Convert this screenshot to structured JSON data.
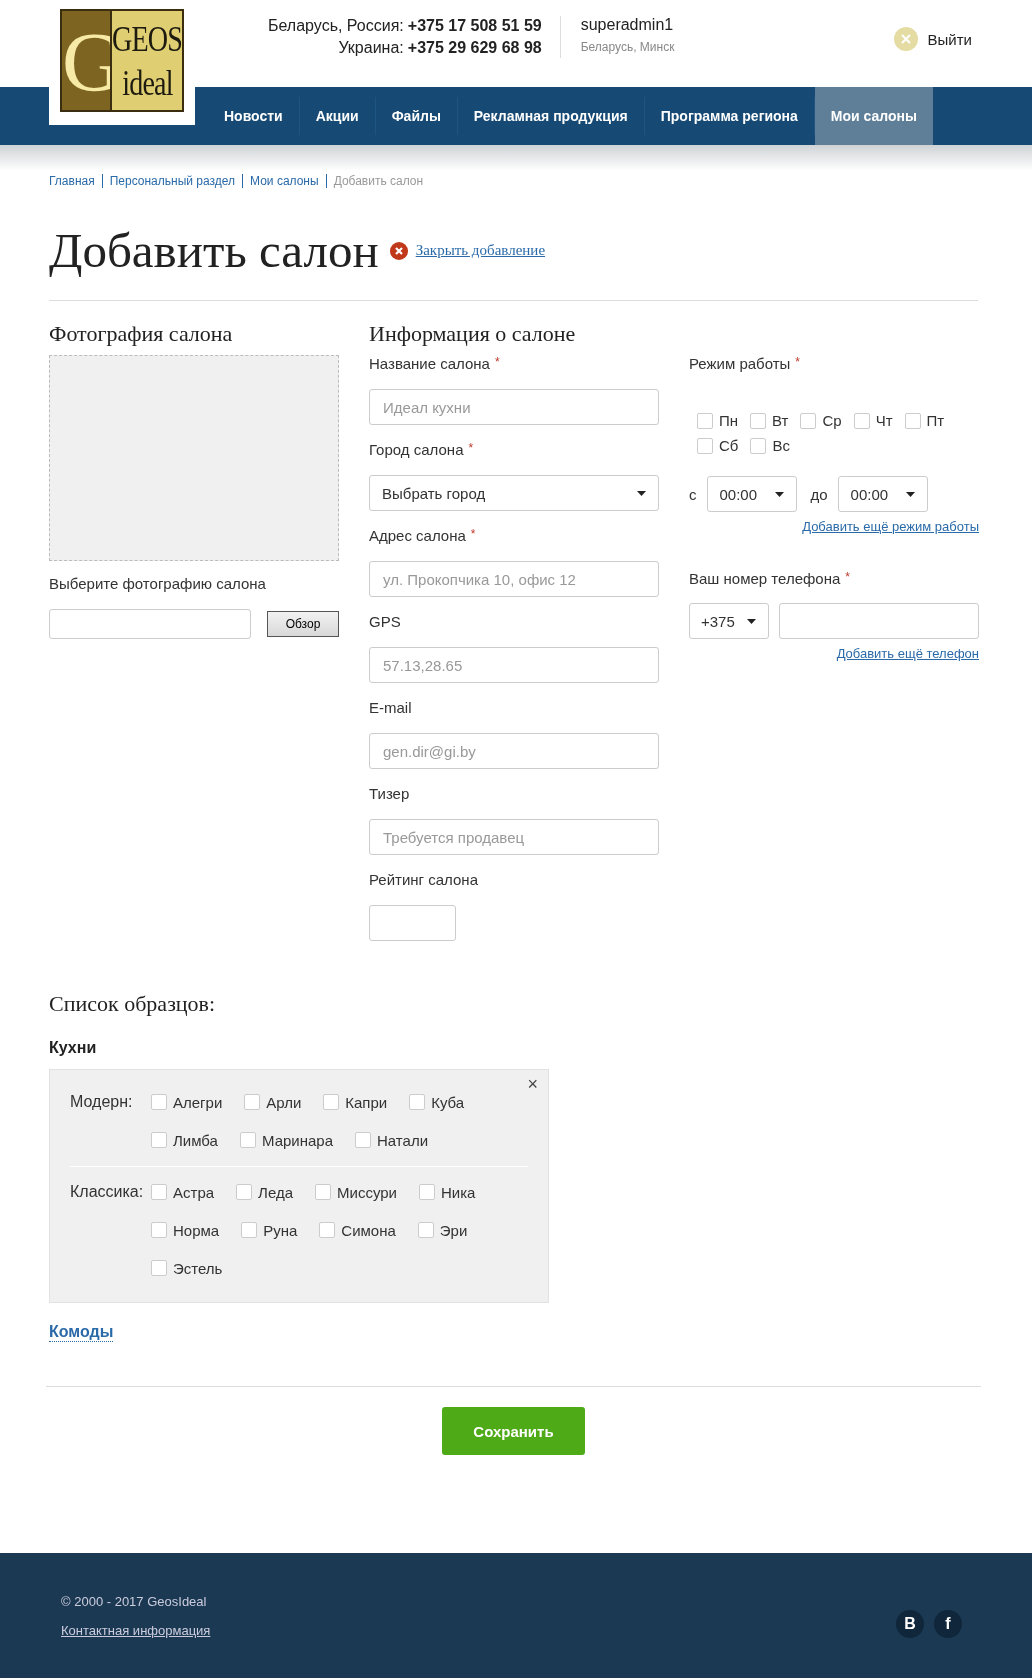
{
  "header": {
    "logo": {
      "letter": "G",
      "top": "GEOS",
      "bottom": "ideal"
    },
    "contacts": [
      {
        "label": "Беларусь, Россия:",
        "phone": "+375 17 508 51 59"
      },
      {
        "label": "Украина:",
        "phone": "+375 29 629 68 98"
      }
    ],
    "user": {
      "name": "superadmin1",
      "location": "Беларусь, Минск"
    },
    "logout": {
      "label": "Выйти"
    }
  },
  "nav": [
    {
      "label": "Новости",
      "selected": false
    },
    {
      "label": "Акции",
      "selected": false
    },
    {
      "label": "Файлы",
      "selected": false
    },
    {
      "label": "Рекламная продукция",
      "selected": false
    },
    {
      "label": "Программа региона",
      "selected": false
    },
    {
      "label": "Мои салоны",
      "selected": true
    }
  ],
  "breadcrumbs": [
    {
      "label": "Главная",
      "current": false
    },
    {
      "label": "Персональный раздел",
      "current": false
    },
    {
      "label": "Мои салоны",
      "current": false
    },
    {
      "label": "Добавить салон",
      "current": true
    }
  ],
  "page_title": "Добавить салон",
  "close_link": "Закрыть добавление",
  "required_mark": "*",
  "photo": {
    "title": "Фотография салона",
    "upload_label": "Выберите фотографию салона",
    "browse_button": "Обзор"
  },
  "info": {
    "title": "Информация о салоне",
    "fields": [
      {
        "label": "Название салона",
        "required": true,
        "kind": "input",
        "placeholder": "Идеал кухни"
      },
      {
        "label": "Город салона",
        "required": true,
        "kind": "select",
        "value": "Выбрать город"
      },
      {
        "label": "Адрес салона",
        "required": true,
        "kind": "input",
        "placeholder": "ул. Прокопчика 10, офис 12"
      },
      {
        "label": "GPS",
        "required": false,
        "kind": "input",
        "placeholder": "57.13,28.65"
      },
      {
        "label": "E-mail",
        "required": false,
        "kind": "input",
        "placeholder": "gen.dir@gi.by"
      },
      {
        "label": "Тизер",
        "required": false,
        "kind": "input",
        "placeholder": "Требуется продавец"
      },
      {
        "label": "Рейтинг салона",
        "required": false,
        "kind": "short"
      }
    ]
  },
  "schedule": {
    "label": "Режим работы",
    "required": true,
    "days": [
      {
        "label": "Пн",
        "checked": false
      },
      {
        "label": "Вт",
        "checked": false
      },
      {
        "label": "Ср",
        "checked": false
      },
      {
        "label": "Чт",
        "checked": false
      },
      {
        "label": "Пт",
        "checked": false
      },
      {
        "label": "Сб",
        "checked": false
      },
      {
        "label": "Вс",
        "checked": false
      }
    ],
    "from_label": "с",
    "from": "00:00",
    "to_label": "до",
    "to": "00:00",
    "add_link": "Добавить ещё режим работы"
  },
  "phone": {
    "label": "Ваш номер телефона",
    "required": true,
    "code": "+375",
    "add_link": "Добавить ещё телефон"
  },
  "samples": {
    "title": "Список образцов:",
    "groups": [
      {
        "title": "Кухни",
        "kind": "panel",
        "close": "×",
        "rows": [
          {
            "label": "Модерн:",
            "items": [
              {
                "label": "Алегри",
                "checked": false
              },
              {
                "label": "Арли",
                "checked": false
              },
              {
                "label": "Капри",
                "checked": false
              },
              {
                "label": "Куба",
                "checked": false
              },
              {
                "label": "Лимба",
                "checked": false
              },
              {
                "label": "Маринара",
                "checked": false
              },
              {
                "label": "Натали",
                "checked": false
              }
            ]
          },
          {
            "label": "Классика:",
            "items": [
              {
                "label": "Астра",
                "checked": false
              },
              {
                "label": "Леда",
                "checked": false
              },
              {
                "label": "Миссури",
                "checked": false
              },
              {
                "label": "Ника",
                "checked": false
              },
              {
                "label": "Норма",
                "checked": false
              },
              {
                "label": "Руна",
                "checked": false
              },
              {
                "label": "Симона",
                "checked": false
              },
              {
                "label": "Эри",
                "checked": false
              },
              {
                "label": "Эстель",
                "checked": false
              }
            ]
          }
        ]
      },
      {
        "title": "Комоды",
        "kind": "link"
      }
    ]
  },
  "save_button": "Сохранить",
  "footer": {
    "copyright": "© 2000 - 2017 GeosIdeal",
    "contact_link": "Контактная информация",
    "social": [
      "В",
      "f"
    ]
  }
}
